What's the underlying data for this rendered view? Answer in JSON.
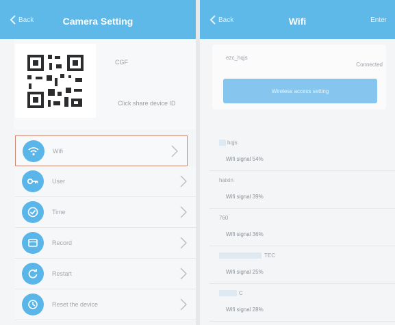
{
  "left": {
    "header": {
      "back_label": "Back",
      "title": "Camera Setting"
    },
    "camera": {
      "id_text": "CGF",
      "share_text": "Click share device ID"
    },
    "menu": [
      {
        "label": "Wifi",
        "icon": "wifi-icon"
      },
      {
        "label": "User",
        "icon": "key-icon"
      },
      {
        "label": "Time",
        "icon": "clock-check-icon"
      },
      {
        "label": "Record",
        "icon": "record-icon"
      },
      {
        "label": "Restart",
        "icon": "restart-icon"
      },
      {
        "label": "Reset the device",
        "icon": "reset-icon"
      }
    ],
    "accent": "#5eb8e8",
    "selected_border": "#c9866e"
  },
  "right": {
    "header": {
      "back_label": "Back",
      "title": "Wifi",
      "action_label": "Enter"
    },
    "connected": {
      "ssid": "ezc_hqjs",
      "status": "Connected",
      "button_label": "Wireless access setting"
    },
    "networks": [
      {
        "name": "hqjs",
        "signal": "Wifi signal  54%"
      },
      {
        "name": "haixin",
        "signal": "Wifi signal  39%"
      },
      {
        "name": "760",
        "signal": "Wifi signal  36%"
      },
      {
        "name": "TEC",
        "signal": "Wifi signal  25%"
      },
      {
        "name": "C",
        "signal": "Wifi signal  28%"
      }
    ]
  }
}
